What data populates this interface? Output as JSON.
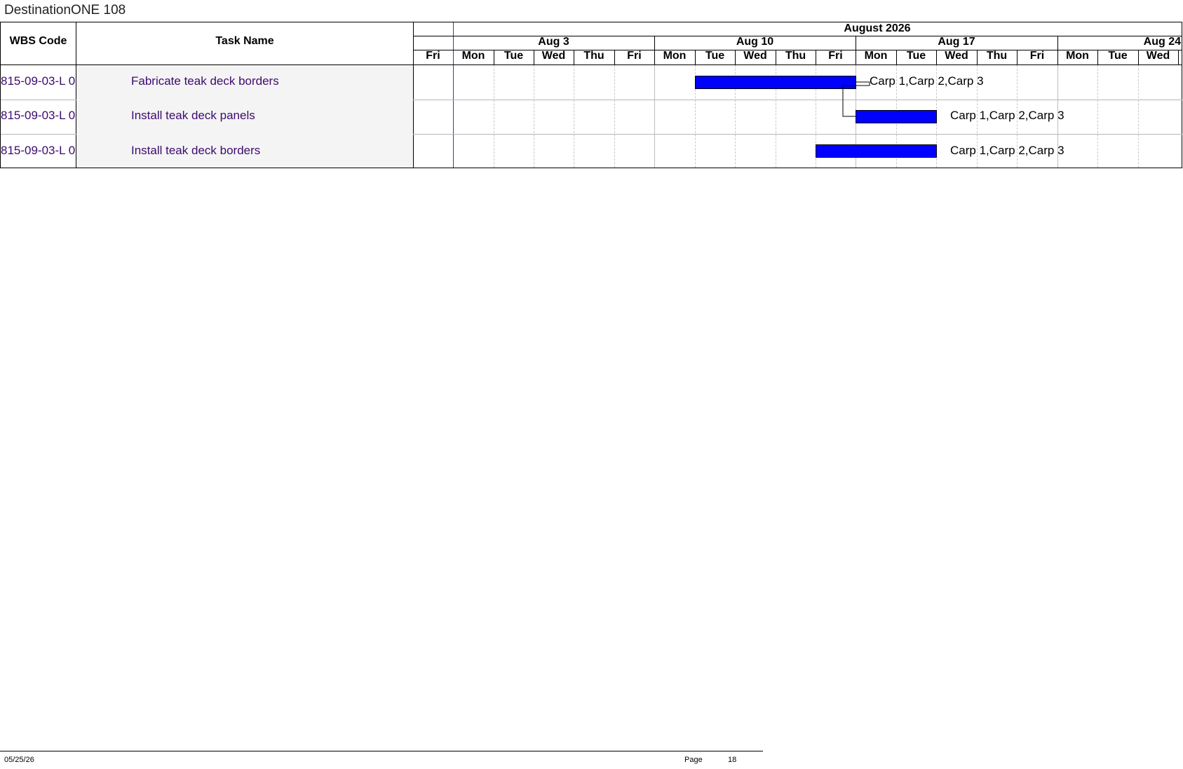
{
  "document": {
    "title": "DestinationONE 108"
  },
  "columns": {
    "wbs_header": "WBS Code",
    "task_header": "Task Name"
  },
  "timescale": {
    "month_label": "August 2026",
    "weeks": [
      "Aug 3",
      "Aug 10",
      "Aug 17",
      "Aug 24"
    ],
    "days": [
      "Fri",
      "Mon",
      "Tue",
      "Wed",
      "Thu",
      "Fri",
      "Mon",
      "Tue",
      "Wed",
      "Thu",
      "Fri",
      "Mon",
      "Tue",
      "Wed",
      "Thu",
      "Fri",
      "Mon",
      "Tue",
      "Wed"
    ]
  },
  "tasks": [
    {
      "wbs": "815-09-03-L 0",
      "name": "Fabricate teak deck borders",
      "resources": "Carp 1,Carp 2,Carp 3",
      "start": "Aug 11",
      "finish": "Aug 14"
    },
    {
      "wbs": "815-09-03-L 0",
      "name": "Install teak deck panels",
      "resources": "Carp 1,Carp 2,Carp 3",
      "start": "Aug 17",
      "finish": "Aug 18"
    },
    {
      "wbs": "815-09-03-L 0",
      "name": "Install teak deck borders",
      "resources": "Carp 1,Carp 2,Carp 3",
      "start": "Aug 14",
      "finish": "Aug 18"
    }
  ],
  "colors": {
    "bar": "#0000ff",
    "task_text": "#3d0a6e"
  },
  "footer": {
    "date": "05/25/26",
    "page_label": "Page",
    "page_number": "18"
  }
}
